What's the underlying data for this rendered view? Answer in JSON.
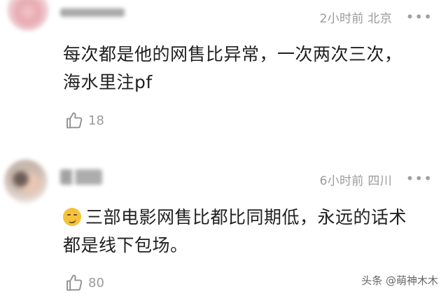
{
  "comments": [
    {
      "time": "2小时前",
      "location": "北京",
      "text_line1": "每次都是他的网售比异常，一次两次三次，",
      "text_line2": "海水里注pf",
      "likes": "18",
      "more_icon": "more-dots-icon"
    },
    {
      "time": "6小时前",
      "location": "四川",
      "text_line1": "三部电影网售比都比同期低，永远的话术",
      "text_line2": "都是线下包场。",
      "likes": "80",
      "emoji_icon": "smirk-emoji-icon",
      "more_icon": "more-dots-icon"
    }
  ],
  "watermark": "头条 @萌神木木"
}
